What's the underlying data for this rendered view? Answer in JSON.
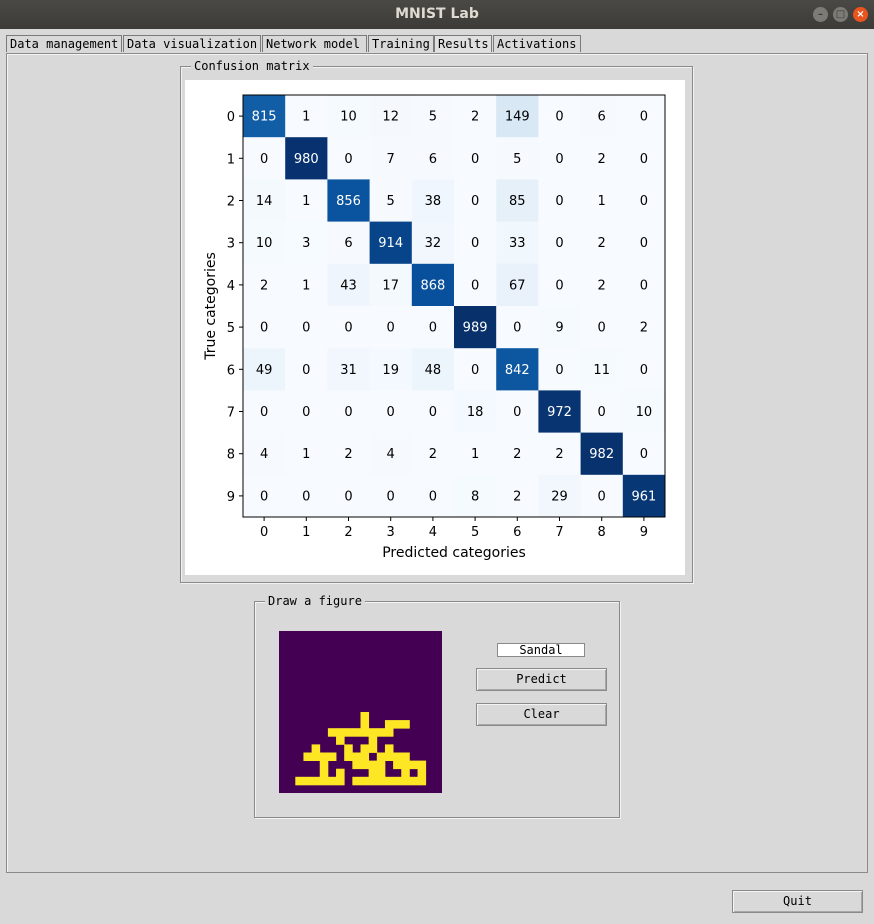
{
  "window": {
    "title": "MNIST Lab"
  },
  "tabs": [
    {
      "label": "Data management"
    },
    {
      "label": "Data visualization"
    },
    {
      "label": "Network model"
    },
    {
      "label": "Training"
    },
    {
      "label": "Results"
    },
    {
      "label": "Activations"
    }
  ],
  "active_tab": "Results",
  "confusion_group": {
    "title": "Confusion matrix"
  },
  "draw_group": {
    "title": "Draw a figure"
  },
  "prediction": {
    "value": "Sandal"
  },
  "buttons": {
    "predict": "Predict",
    "clear": "Clear",
    "quit": "Quit"
  },
  "colors": {
    "cmap": "Blues",
    "drawing_background": "#440154",
    "drawing_stroke": "#fde725"
  },
  "drawing": {
    "rows": [
      "....................",
      "....................",
      "....................",
      "....................",
      "....................",
      "....................",
      "....................",
      "....................",
      "....................",
      "....................",
      "..........X.........",
      "..........X..XXX....",
      "......XXXXXXXX......",
      ".......X...X........",
      "....X...X.XX.X......",
      "...XXXX.XXX.XXXX....",
      ".....X...XXXX.XXXX..",
      ".....X.X...XX..X.X..",
      "..XXXXXX.XXXXXXXXX..",
      "...................."
    ]
  },
  "chart_data": {
    "type": "heatmap",
    "title": "",
    "xlabel": "Predicted categories",
    "ylabel": "True categories",
    "x_ticks": [
      "0",
      "1",
      "2",
      "3",
      "4",
      "5",
      "6",
      "7",
      "8",
      "9"
    ],
    "y_ticks": [
      "0",
      "1",
      "2",
      "3",
      "4",
      "5",
      "6",
      "7",
      "8",
      "9"
    ],
    "colormap": "Blues",
    "matrix": [
      [
        815,
        1,
        10,
        12,
        5,
        2,
        149,
        0,
        6,
        0
      ],
      [
        0,
        980,
        0,
        7,
        6,
        0,
        5,
        0,
        2,
        0
      ],
      [
        14,
        1,
        856,
        5,
        38,
        0,
        85,
        0,
        1,
        0
      ],
      [
        10,
        3,
        6,
        914,
        32,
        0,
        33,
        0,
        2,
        0
      ],
      [
        2,
        1,
        43,
        17,
        868,
        0,
        67,
        0,
        2,
        0
      ],
      [
        0,
        0,
        0,
        0,
        0,
        989,
        0,
        9,
        0,
        2
      ],
      [
        49,
        0,
        31,
        19,
        48,
        0,
        842,
        0,
        11,
        0
      ],
      [
        0,
        0,
        0,
        0,
        0,
        18,
        0,
        972,
        0,
        10
      ],
      [
        4,
        1,
        2,
        4,
        2,
        1,
        2,
        2,
        982,
        0
      ],
      [
        0,
        0,
        0,
        0,
        0,
        8,
        2,
        29,
        0,
        961
      ]
    ]
  }
}
